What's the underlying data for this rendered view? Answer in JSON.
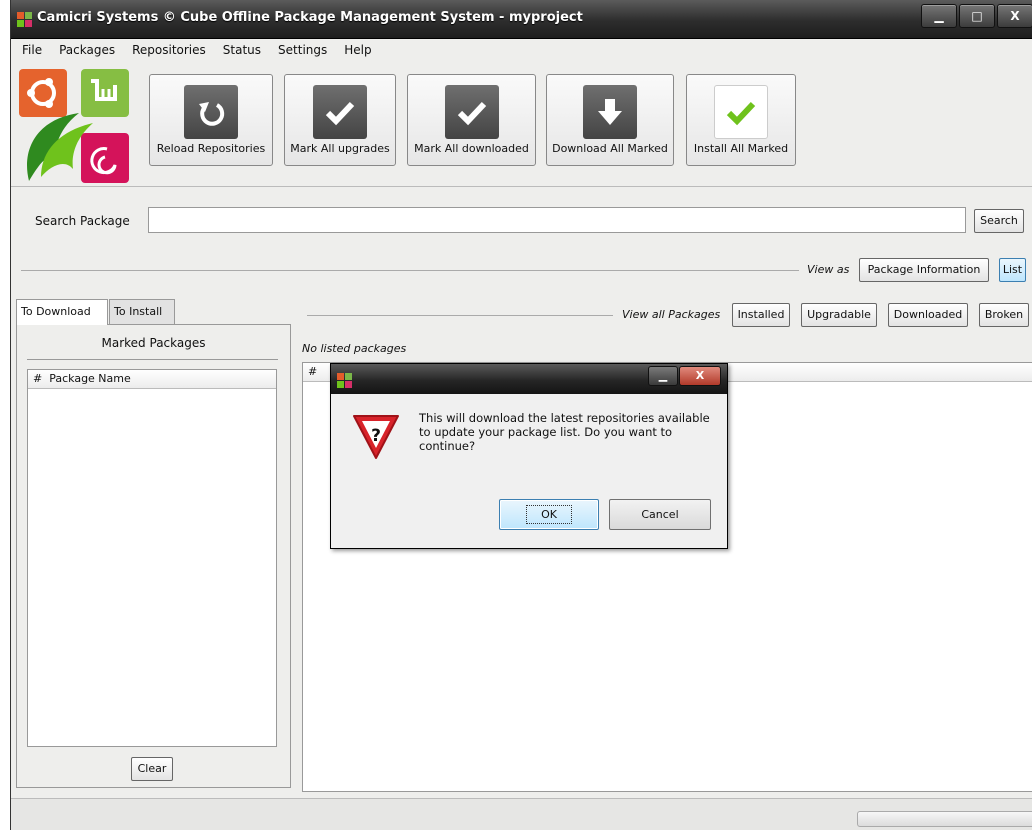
{
  "window": {
    "title": "Camicri Systems © Cube Offline Package Management System - myproject",
    "controls": {
      "minimize": "▁",
      "maximize": "□",
      "close": "X"
    }
  },
  "menu": [
    "File",
    "Packages",
    "Repositories",
    "Status",
    "Settings",
    "Help"
  ],
  "toolbar": {
    "reload": "Reload Repositories",
    "mark_upgrades": "Mark All upgrades",
    "mark_downloaded": "Mark All downloaded",
    "download_marked": "Download All Marked",
    "install_marked": "Install All Marked"
  },
  "search": {
    "label": "Search Package",
    "value": "",
    "button": "Search"
  },
  "view": {
    "label": "View as",
    "package_info": "Package Information",
    "list": "List"
  },
  "tabs": {
    "to_download": "To Download",
    "to_install": "To Install"
  },
  "left_panel": {
    "title": "Marked Packages",
    "col_num": "#",
    "col_name": "Package Name",
    "clear": "Clear"
  },
  "filters": {
    "label": "View all Packages",
    "installed": "Installed",
    "upgradable": "Upgradable",
    "downloaded": "Downloaded",
    "broken": "Broken"
  },
  "main": {
    "status": "No listed packages",
    "col_num": "#"
  },
  "dialog": {
    "message": "This will download the latest repositories available to update your package list. Do you want to continue?",
    "ok": "OK",
    "cancel": "Cancel"
  },
  "colors": {
    "accent_green": "#6fc21c",
    "warning_red": "#d8232a"
  }
}
